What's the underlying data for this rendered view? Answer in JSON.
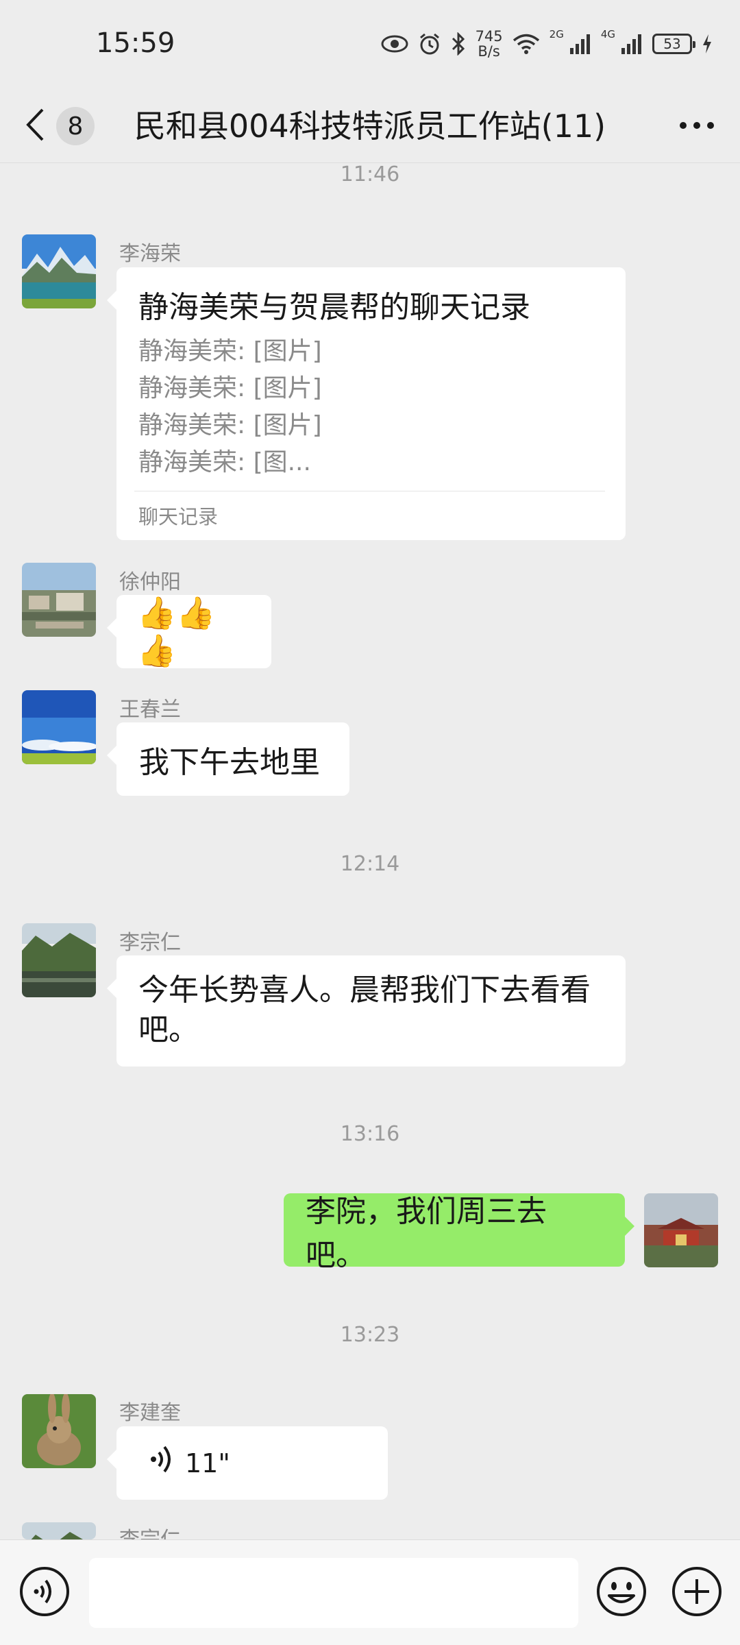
{
  "status_bar": {
    "time": "15:59",
    "net_speed_value": "745",
    "net_speed_unit": "B/s",
    "signal1_label": "2G",
    "signal2_label": "4G",
    "battery": "53"
  },
  "nav": {
    "unread_count": "8",
    "title": "民和县004科技特派员工作站(11)"
  },
  "timestamps": [
    "11:46",
    "12:14",
    "13:16",
    "13:23"
  ],
  "messages": [
    {
      "sender": "李海荣",
      "type": "chat_record",
      "record_title": "静海美荣与贺晨帮的聊天记录",
      "record_lines": [
        "静海美荣: [图片]",
        "静海美荣: [图片]",
        "静海美荣: [图片]",
        "静海美荣: [图..."
      ],
      "record_footer": "聊天记录"
    },
    {
      "sender": "徐仲阳",
      "type": "emoji",
      "text": "👍👍👍"
    },
    {
      "sender": "王春兰",
      "type": "text",
      "text": "我下午去地里"
    },
    {
      "sender": "李宗仁",
      "type": "text",
      "text": "今年长势喜人。晨帮我们下去看看吧。"
    },
    {
      "sender": "me",
      "type": "text",
      "text": "李院，我们周三去吧。"
    },
    {
      "sender": "李建奎",
      "type": "voice",
      "duration": "11\""
    },
    {
      "sender": "李宗仁",
      "type": "partial"
    }
  ],
  "icons": {
    "back": "chevron-left-icon",
    "more": "more-horizontal-icon",
    "voice": "voice-input-icon",
    "emoji": "emoji-icon",
    "plus": "plus-icon"
  },
  "colors": {
    "background": "#ededed",
    "bubble_mine": "#95ec69",
    "bubble_other": "#ffffff",
    "secondary_text": "#8a8a8a"
  }
}
